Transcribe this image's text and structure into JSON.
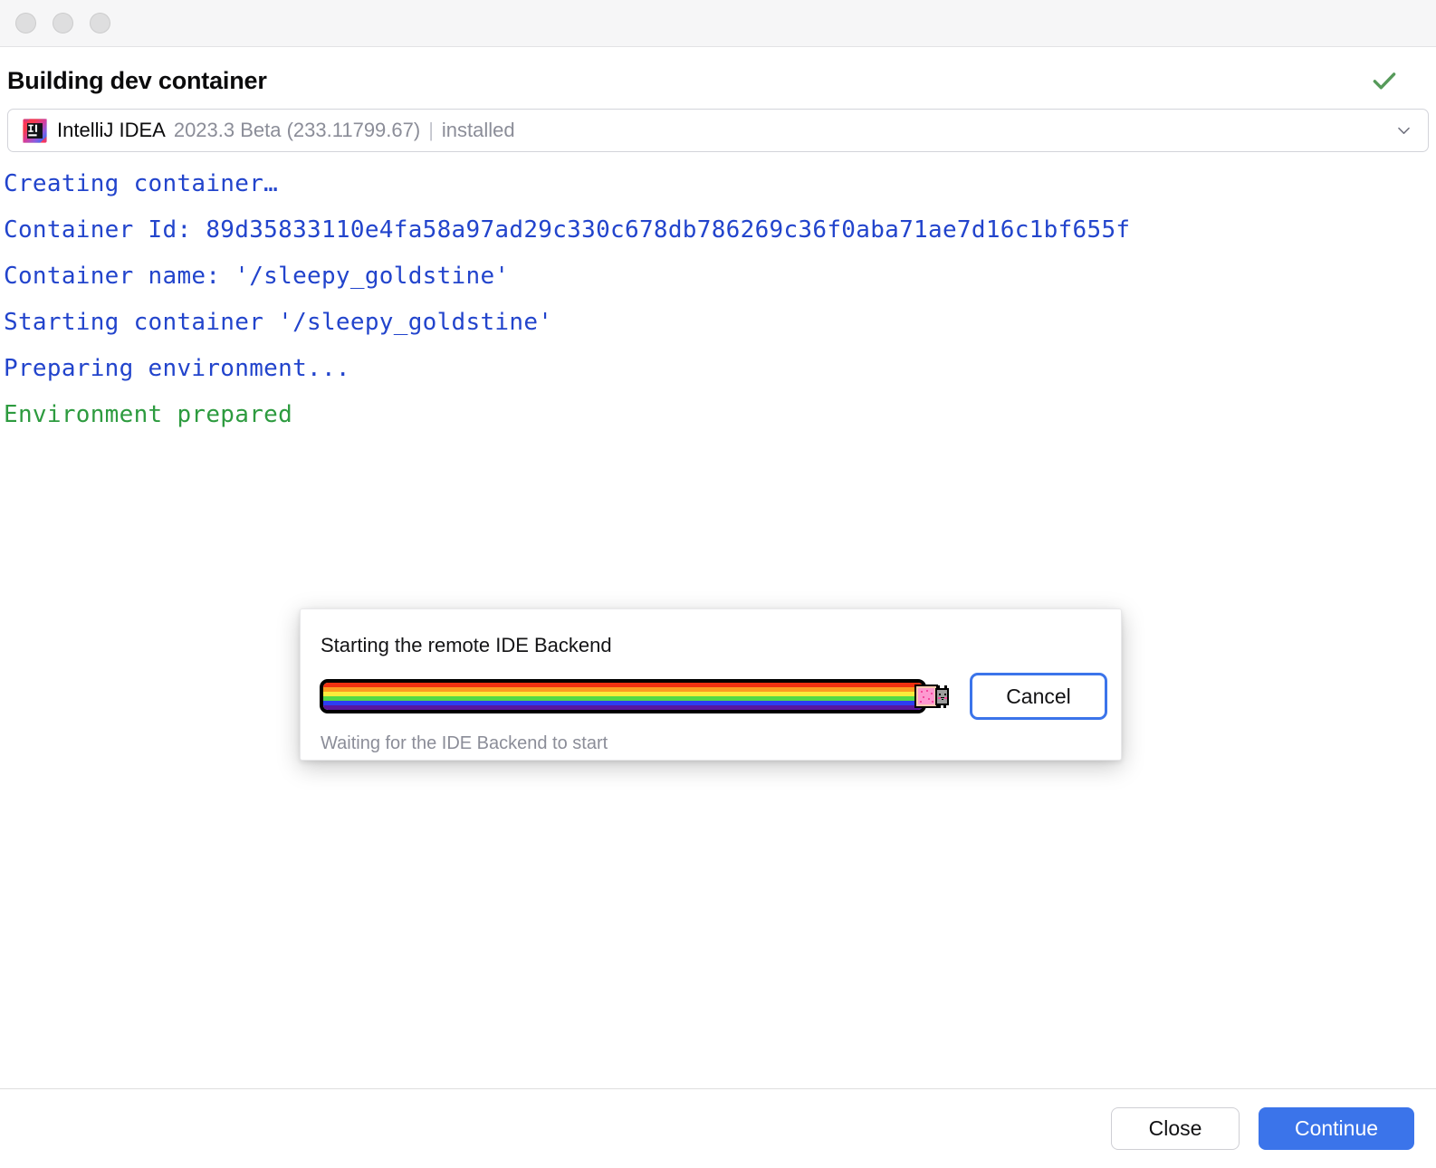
{
  "titlebar": {
    "lights": [
      "close-button",
      "minimize-button",
      "zoom-button"
    ]
  },
  "header": {
    "title": "Building dev container",
    "status_icon": "check-icon",
    "status_color": "#569a5a"
  },
  "ide_selector": {
    "icon": "intellij-idea-icon",
    "name": "IntelliJ IDEA",
    "version": "2023.3 Beta (233.11799.67)",
    "separator": "|",
    "status": "installed",
    "chevron": "chevron-down-icon"
  },
  "console": {
    "lines": [
      {
        "text": "Creating container…",
        "color": "#2244cc"
      },
      {
        "text": "Container Id: 89d35833110e4fa58a97ad29c330c678db786269c36f0aba71ae7d16c1bf655f",
        "color": "#2244cc"
      },
      {
        "text": "Container name: '/sleepy_goldstine'",
        "color": "#2244cc"
      },
      {
        "text": "Starting container '/sleepy_goldstine'",
        "color": "#2244cc"
      },
      {
        "text": "Preparing environment...",
        "color": "#2244cc"
      },
      {
        "text": "Environment prepared",
        "color": "#2d9b3f"
      }
    ]
  },
  "modal": {
    "title": "Starting the remote IDE Backend",
    "status": "Waiting for the IDE Backend to start",
    "cancel_label": "Cancel",
    "progress": {
      "style": "nyan-cat",
      "percent": 96,
      "rainbow_colors": [
        "#f03010",
        "#fb9b22",
        "#f9ec3b",
        "#53d947",
        "#2c3ef2",
        "#5a179e"
      ],
      "sprite": "nyan-cat-icon"
    }
  },
  "footer": {
    "close_label": "Close",
    "continue_label": "Continue",
    "primary_color": "#3b74ea"
  }
}
